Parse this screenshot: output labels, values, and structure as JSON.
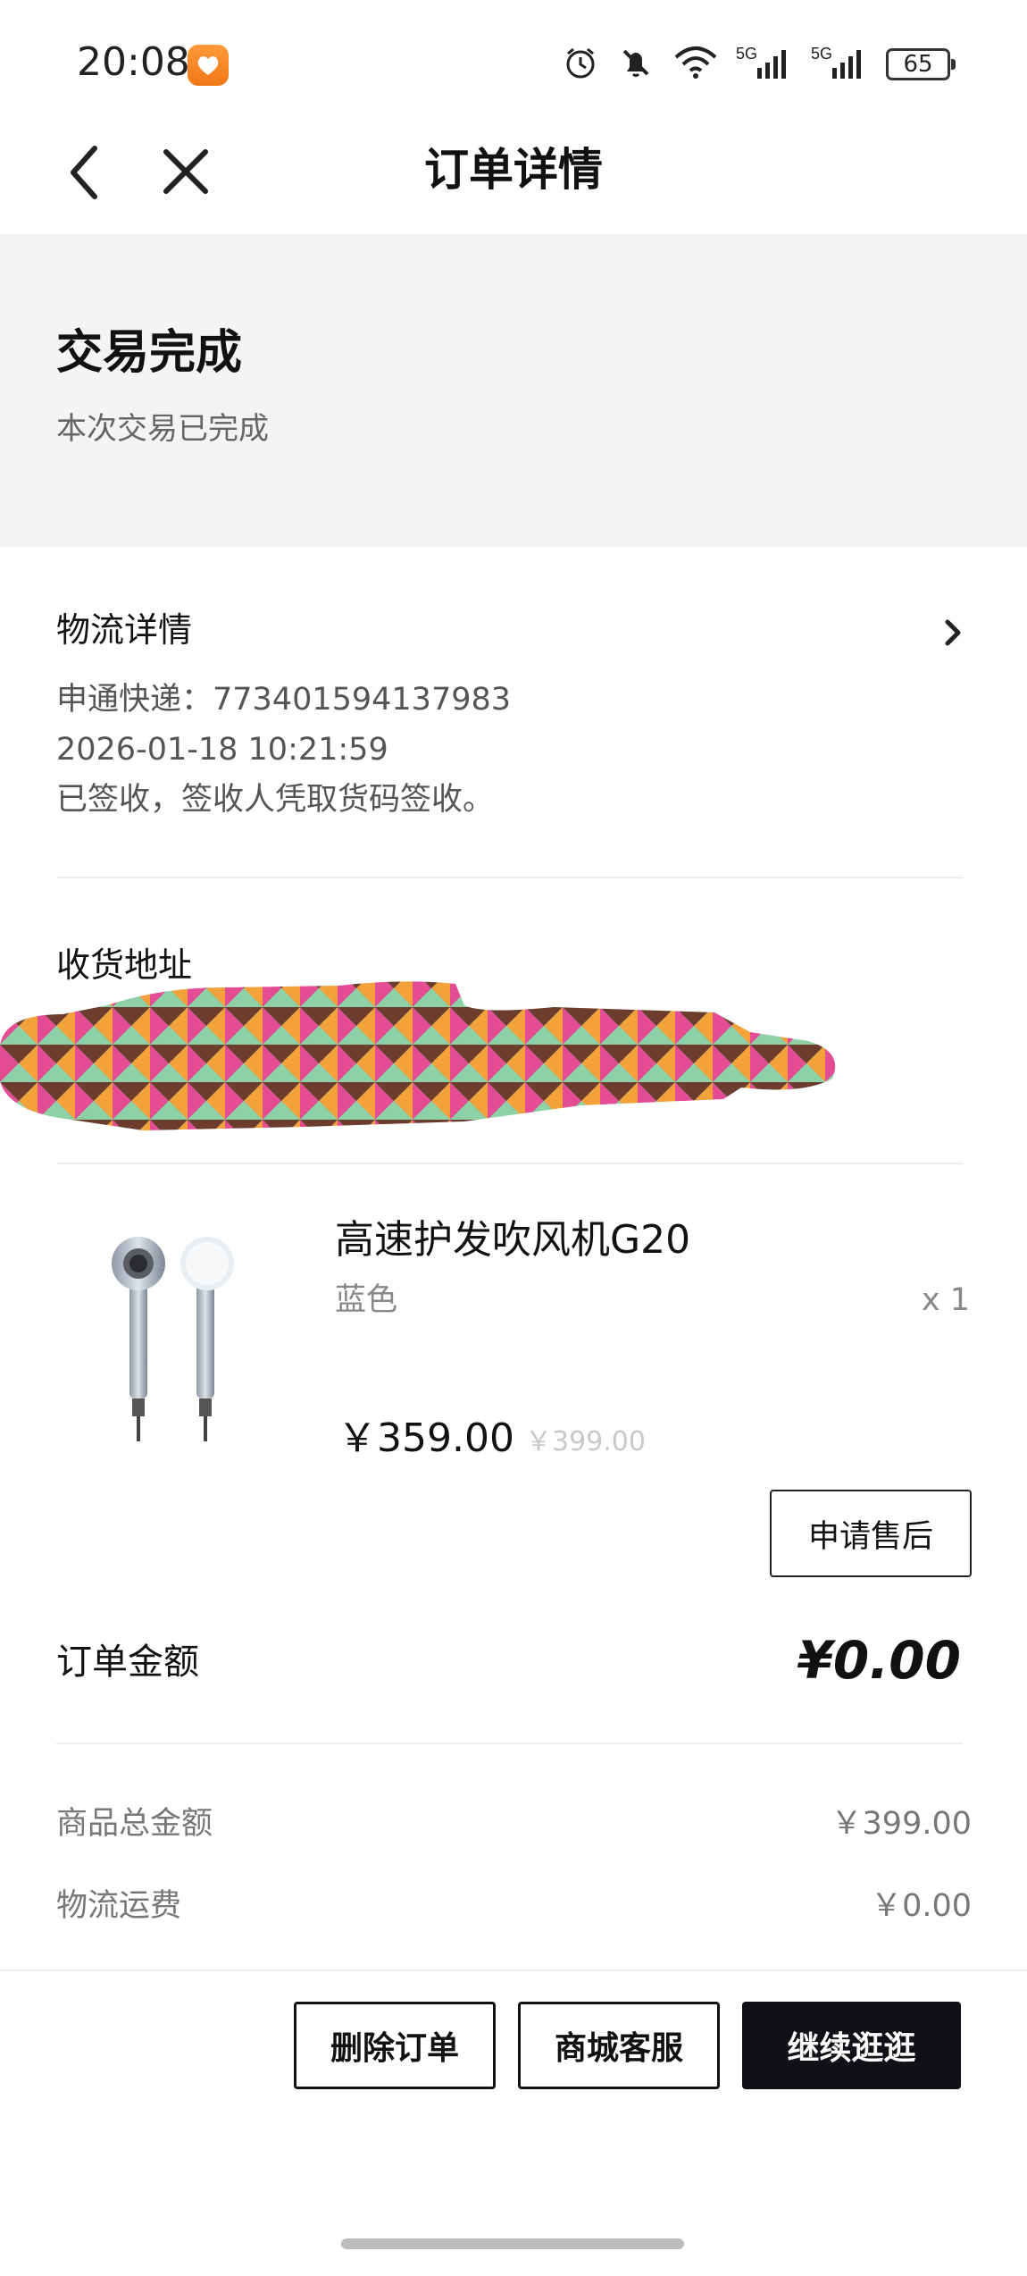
{
  "status_bar": {
    "time": "20:08",
    "battery": "65",
    "network_label_1": "5G",
    "network_label_2": "5G"
  },
  "header": {
    "title": "订单详情"
  },
  "order_status": {
    "title": "交易完成",
    "subtitle": "本次交易已完成"
  },
  "logistics": {
    "title": "物流详情",
    "courier": "申通快递：773401594137983",
    "timestamp": "2026-01-18 10:21:59",
    "status": "已签收，签收人凭取货码签收。"
  },
  "address": {
    "title": "收货地址"
  },
  "product": {
    "name": "高速护发吹风机G20",
    "variant": "蓝色",
    "quantity": "x 1",
    "price": "￥359.00",
    "original_price": "￥399.00",
    "after_sale_label": "申请售后"
  },
  "order_amount": {
    "label": "订单金额",
    "value": "¥0.00"
  },
  "summary": {
    "goods_total_label": "商品总金额",
    "goods_total_value": "￥399.00",
    "shipping_label": "物流运费",
    "shipping_value": "￥0.00"
  },
  "actions": {
    "delete_label": "删除订单",
    "service_label": "商城客服",
    "continue_label": "继续逛逛"
  },
  "colors": {
    "dark_button": "#0f1116",
    "banner_bg": "#f4f4f4"
  },
  "icons": [
    "back-icon",
    "close-icon",
    "chevron-right-icon",
    "wifi-icon",
    "alarm-icon",
    "mute-icon",
    "signal-icon",
    "battery-icon"
  ]
}
